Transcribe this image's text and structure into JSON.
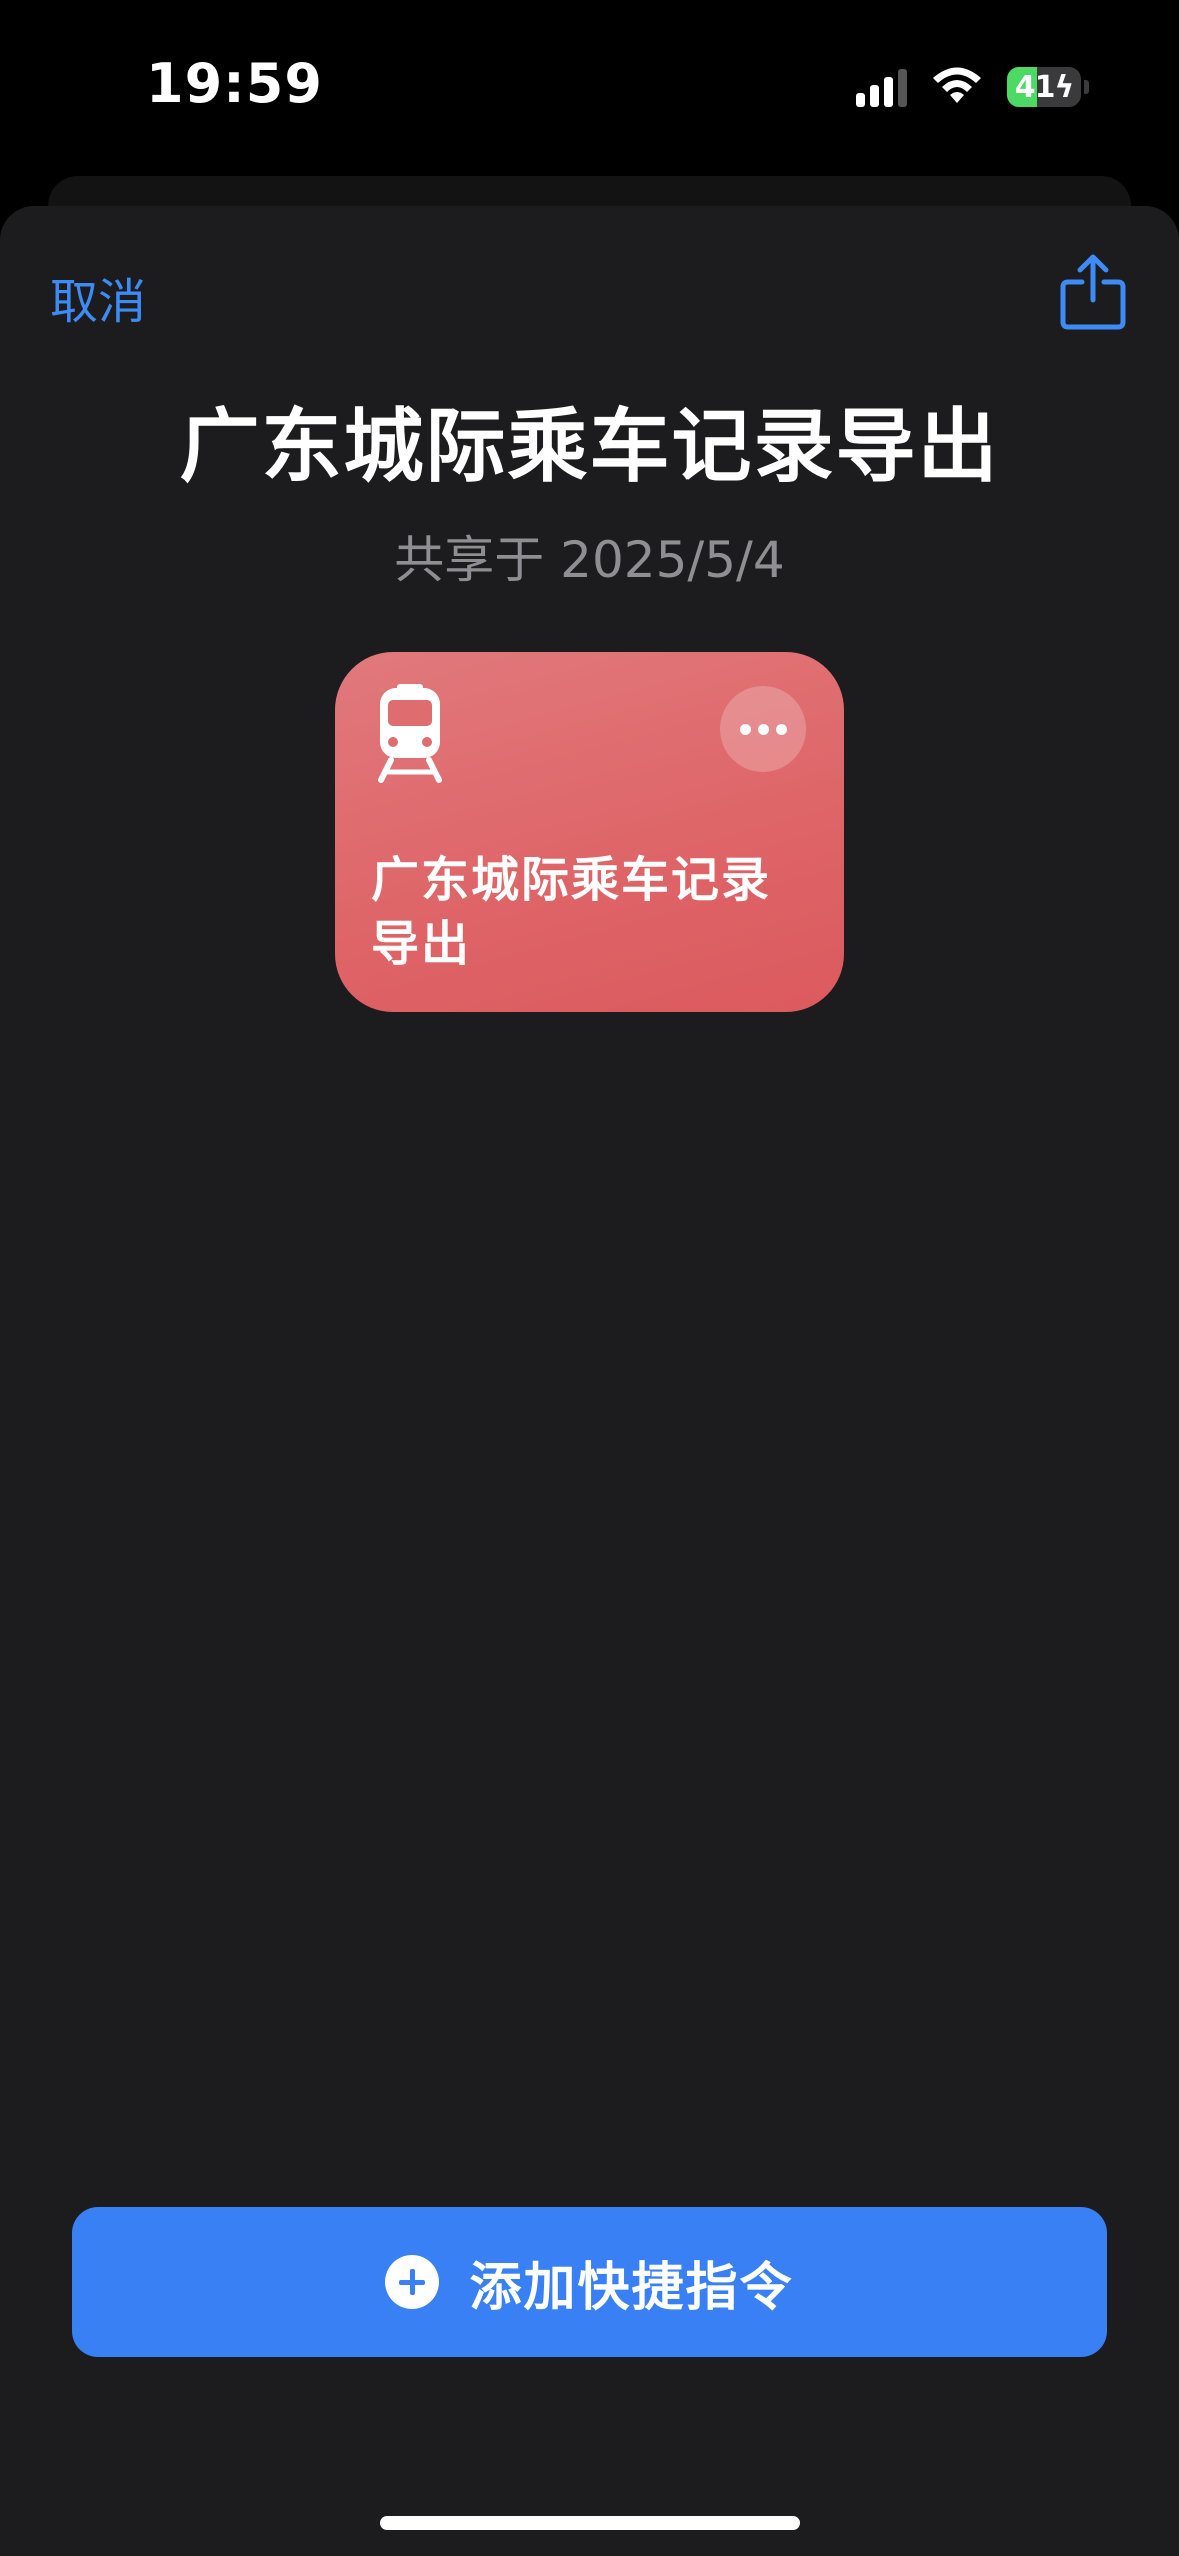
{
  "status_bar": {
    "time": "19:59",
    "battery_level": "41",
    "battery_percent": 41,
    "charging": true,
    "icons": [
      "cellular-signal-icon",
      "wifi-icon",
      "battery-charging-icon"
    ]
  },
  "nav": {
    "cancel_label": "取消",
    "share_icon": "share-icon"
  },
  "header": {
    "title": "广东城际乘车记录导出",
    "subtitle": "共享于 2025/5/4"
  },
  "shortcut_card": {
    "title": "广东城际乘车记录导出",
    "icon": "train-icon",
    "more_icon": "ellipsis-icon",
    "color": "#de6467"
  },
  "add_button": {
    "label": "添加快捷指令",
    "icon": "plus-circle-icon",
    "color": "#3880f3"
  },
  "colors": {
    "accent": "#3d8bf5",
    "sheet_background": "#1c1c1e",
    "secondary_text": "#8e8e93"
  }
}
